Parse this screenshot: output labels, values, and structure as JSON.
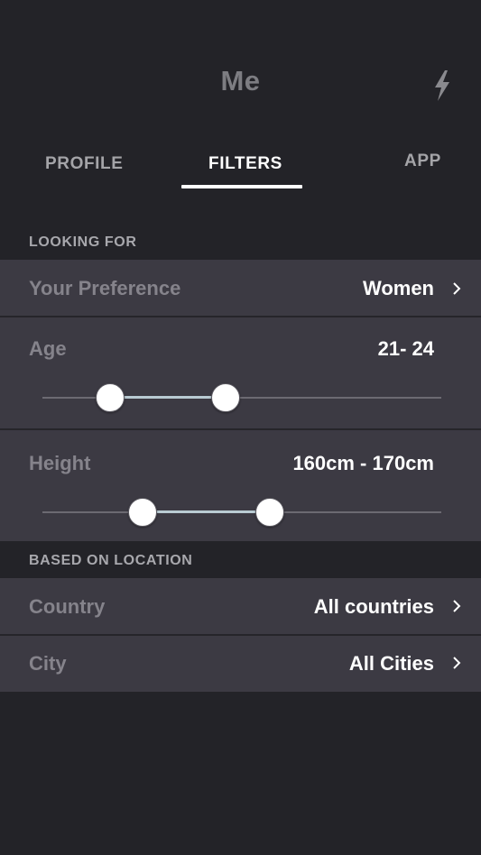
{
  "header": {
    "title": "Me",
    "action_icon": "lightning-bolt-icon"
  },
  "tabs": [
    {
      "label": "PROFILE",
      "active": false
    },
    {
      "label": "FILTERS",
      "active": true
    },
    {
      "label": "APP",
      "active": false
    }
  ],
  "looking_for": {
    "section_label": "LOOKING FOR",
    "preference": {
      "label": "Your Preference",
      "value": "Women"
    },
    "age": {
      "label": "Age",
      "value": "21- 24",
      "range_low_fraction": 0.17,
      "range_high_fraction": 0.46
    },
    "height": {
      "label": "Height",
      "value": "160cm - 170cm",
      "range_low_fraction": 0.25,
      "range_high_fraction": 0.57
    }
  },
  "location": {
    "section_label": "BASED ON LOCATION",
    "country": {
      "label": "Country",
      "value": "All countries"
    },
    "city": {
      "label": "City",
      "value": "All Cities"
    }
  },
  "colors": {
    "background": "#232328",
    "panel": "#3c3a43",
    "accent": "#ffffff",
    "track_active": "#b9cbd3"
  }
}
